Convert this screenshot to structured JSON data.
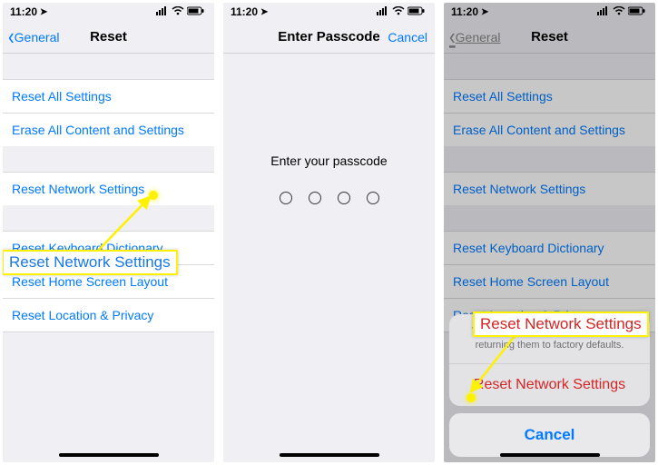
{
  "status": {
    "time": "11:20"
  },
  "screen1": {
    "back": "General",
    "title": "Reset",
    "rows_a": [
      "Reset All Settings",
      "Erase All Content and Settings"
    ],
    "rows_b": [
      "Reset Network Settings"
    ],
    "rows_c": [
      "Reset Keyboard Dictionary",
      "Reset Home Screen Layout",
      "Reset Location & Privacy"
    ],
    "callout": "Reset Network Settings"
  },
  "screen2": {
    "title": "Enter Passcode",
    "cancel": "Cancel",
    "prompt": "Enter your passcode"
  },
  "screen3": {
    "back": "General",
    "title": "Reset",
    "rows_a": [
      "Reset All Settings",
      "Erase All Content and Settings"
    ],
    "rows_b": [
      "Reset Network Settings"
    ],
    "rows_c": [
      "Reset Keyboard Dictionary",
      "Reset Home Screen Layout",
      "Reset Location & Privacy"
    ],
    "callout": "Reset Network Settings",
    "sheet": {
      "msg": "This will delete all network settings, returning them to factory defaults.",
      "action": "Reset Network Settings",
      "cancel": "Cancel"
    }
  }
}
